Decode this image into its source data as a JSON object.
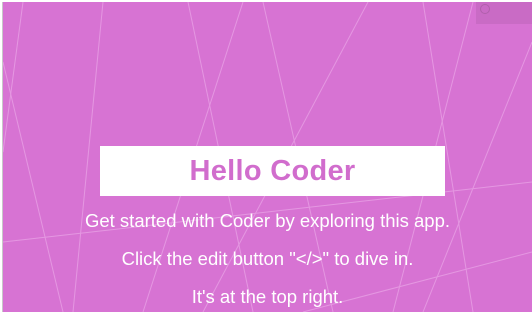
{
  "app": {
    "title": "Hello Coder",
    "lines": [
      "Get started with Coder by exploring this app.",
      "Click the edit button \"</>\" to dive in.",
      "It's at the top right."
    ]
  },
  "colors": {
    "background": "#d773d3",
    "title_text": "#d16dcd",
    "title_box": "#ffffff",
    "body_text": "#ffffff"
  },
  "icons": {
    "corner": "edit-icon"
  }
}
